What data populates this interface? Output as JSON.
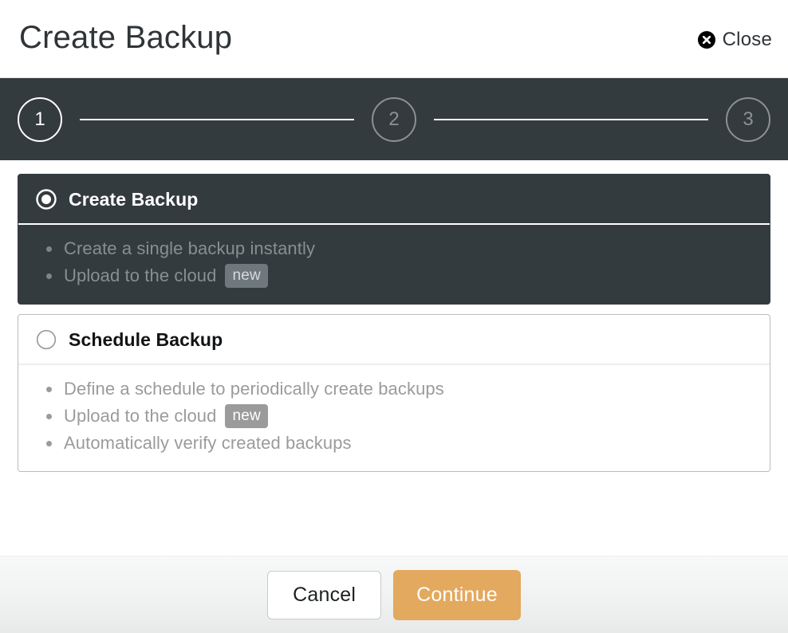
{
  "header": {
    "title": "Create Backup",
    "close_label": "Close",
    "close_icon": "close-circle-icon"
  },
  "stepper": {
    "steps": [
      {
        "number": "1",
        "state": "active"
      },
      {
        "number": "2",
        "state": "inactive"
      },
      {
        "number": "3",
        "state": "inactive"
      }
    ]
  },
  "options": [
    {
      "title": "Create Backup",
      "selected": true,
      "bullets": [
        {
          "text": "Create a single backup instantly",
          "badge": ""
        },
        {
          "text": "Upload to the cloud",
          "badge": "new"
        }
      ]
    },
    {
      "title": "Schedule Backup",
      "selected": false,
      "bullets": [
        {
          "text": "Define a schedule to periodically create backups",
          "badge": ""
        },
        {
          "text": "Upload to the cloud",
          "badge": "new"
        },
        {
          "text": "Automatically verify created backups",
          "badge": ""
        }
      ]
    }
  ],
  "footer": {
    "cancel_label": "Cancel",
    "continue_label": "Continue"
  },
  "colors": {
    "dark_panel": "#343b3f",
    "accent": "#e3a95e",
    "muted_text": "#9b9b9b"
  }
}
